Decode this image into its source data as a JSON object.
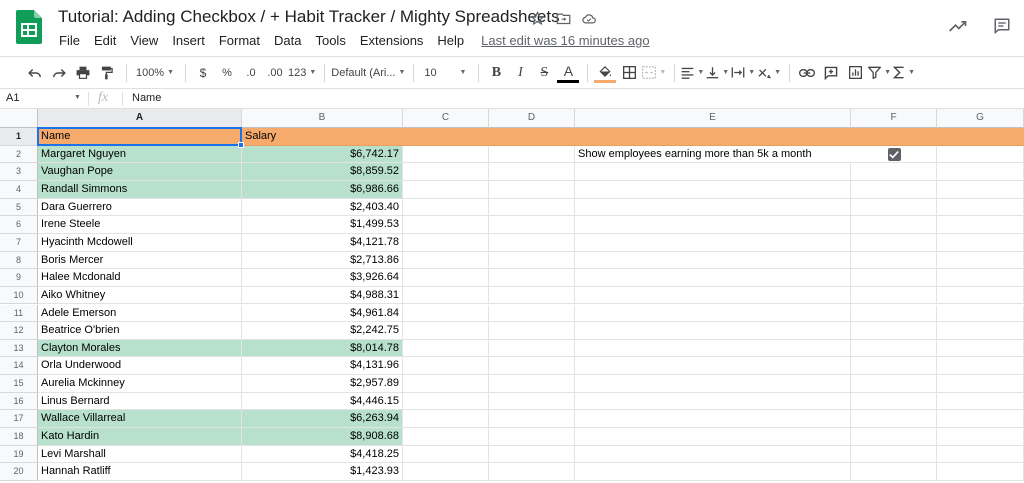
{
  "header": {
    "title": "Tutorial: Adding Checkbox / + Habit Tracker / Mighty Spreadsheets",
    "menu": [
      "File",
      "Edit",
      "View",
      "Insert",
      "Format",
      "Data",
      "Tools",
      "Extensions",
      "Help"
    ],
    "last_edit": "Last edit was 16 minutes ago",
    "icons": [
      "star-icon",
      "move-to-folder-icon",
      "cloud-status-icon",
      "trending-up-icon",
      "comment-icon"
    ]
  },
  "toolbar": {
    "zoom": "100%",
    "currency": "$",
    "percent": "%",
    "decrease_decimal": ".0",
    "increase_decimal": ".00",
    "more_formats": "123",
    "font": "Default (Ari...",
    "font_size": "10",
    "bold": "B",
    "italic": "I",
    "strikethrough": "S",
    "text_color": "A"
  },
  "formula_bar": {
    "cell_ref": "A1",
    "fx": "fx",
    "content": "Name"
  },
  "colors": {
    "header_row": "#f6ab6c",
    "highlight": "#b7e1cd",
    "selection": "#1a73e8"
  },
  "grid": {
    "columns": [
      "A",
      "B",
      "C",
      "D",
      "E",
      "F",
      "G"
    ],
    "row_numbers": [
      "1",
      "2",
      "3",
      "4",
      "5",
      "6",
      "7",
      "8",
      "9",
      "10",
      "11",
      "12",
      "13",
      "14",
      "15",
      "16",
      "17",
      "18",
      "19",
      "20"
    ],
    "headers": {
      "name": "Name",
      "salary": "Salary"
    },
    "note": "Show employees earning more than 5k a month",
    "checkbox_checked": true,
    "rows": [
      {
        "name": "Margaret Nguyen",
        "salary": "$6,742.17",
        "highlight": true
      },
      {
        "name": "Vaughan Pope",
        "salary": "$8,859.52",
        "highlight": true
      },
      {
        "name": "Randall Simmons",
        "salary": "$6,986.66",
        "highlight": true
      },
      {
        "name": "Dara Guerrero",
        "salary": "$2,403.40",
        "highlight": false
      },
      {
        "name": "Irene Steele",
        "salary": "$1,499.53",
        "highlight": false
      },
      {
        "name": "Hyacinth Mcdowell",
        "salary": "$4,121.78",
        "highlight": false
      },
      {
        "name": "Boris Mercer",
        "salary": "$2,713.86",
        "highlight": false
      },
      {
        "name": "Halee Mcdonald",
        "salary": "$3,926.64",
        "highlight": false
      },
      {
        "name": "Aiko Whitney",
        "salary": "$4,988.31",
        "highlight": false
      },
      {
        "name": "Adele Emerson",
        "salary": "$4,961.84",
        "highlight": false
      },
      {
        "name": "Beatrice O'brien",
        "salary": "$2,242.75",
        "highlight": false
      },
      {
        "name": "Clayton Morales",
        "salary": "$8,014.78",
        "highlight": true
      },
      {
        "name": "Orla Underwood",
        "salary": "$4,131.96",
        "highlight": false
      },
      {
        "name": "Aurelia Mckinney",
        "salary": "$2,957.89",
        "highlight": false
      },
      {
        "name": "Linus Bernard",
        "salary": "$4,446.15",
        "highlight": false
      },
      {
        "name": "Wallace Villarreal",
        "salary": "$6,263.94",
        "highlight": true
      },
      {
        "name": "Kato Hardin",
        "salary": "$8,908.68",
        "highlight": true
      },
      {
        "name": "Levi Marshall",
        "salary": "$4,418.25",
        "highlight": false
      },
      {
        "name": "Hannah Ratliff",
        "salary": "$1,423.93",
        "highlight": false
      }
    ]
  }
}
